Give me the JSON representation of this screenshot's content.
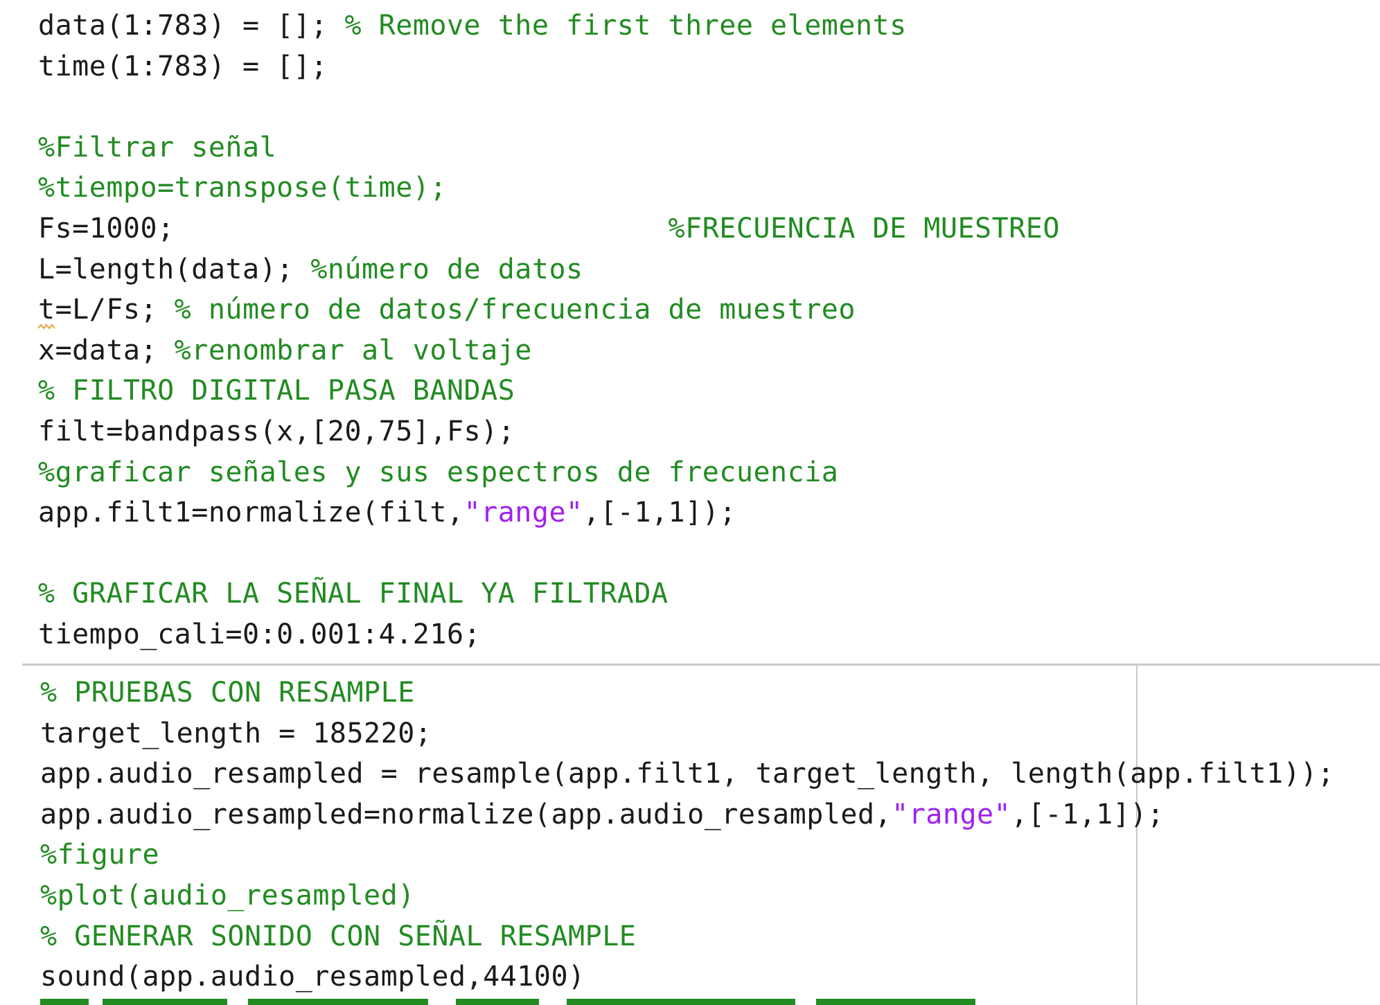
{
  "editor": {
    "section1": [
      {
        "code": "data(1:783) = []; ",
        "comment": "% Remove the first three elements"
      },
      {
        "code": "time(1:783) = [];"
      },
      {
        "code": ""
      },
      {
        "comment": "%Filtrar señal"
      },
      {
        "comment": "%tiempo=transpose(time);"
      },
      {
        "code": "Fs=1000;                             ",
        "comment": "%FRECUENCIA DE MUESTREO"
      },
      {
        "code": "L=length(data); ",
        "comment": "%número de datos"
      },
      {
        "code": "t=L/Fs; ",
        "comment": "% número de datos/frecuencia de muestreo"
      },
      {
        "code": "x=data; ",
        "comment": "%renombrar al voltaje"
      },
      {
        "comment": "% FILTRO DIGITAL PASA BANDAS"
      },
      {
        "code": "filt=bandpass(x,[20,75],Fs);"
      },
      {
        "comment": "%graficar señales y sus espectros de frecuencia"
      },
      {
        "code": "app.filt1=normalize(filt,",
        "string": "\"range\"",
        "after": ",[-1,1]);"
      },
      {
        "code": ""
      },
      {
        "comment": "% GRAFICAR LA SEÑAL FINAL YA FILTRADA"
      },
      {
        "code": "tiempo_cali=0:0.001:4.216;"
      }
    ],
    "section2": [
      {
        "comment": "% PRUEBAS CON RESAMPLE"
      },
      {
        "code": "target_length = 185220;"
      },
      {
        "code": "app.audio_resampled = resample(app.filt1, target_length, length(app.filt1));"
      },
      {
        "code": "app.audio_resampled=normalize(app.audio_resampled,",
        "string": "\"range\"",
        "after": ",[-1,1]);"
      },
      {
        "comment": "%figure"
      },
      {
        "comment": "%plot(audio_resampled)"
      },
      {
        "comment": "% GENERAR SONIDO CON SEÑAL RESAMPLE"
      },
      {
        "code": "sound(app.audio_resampled,44100)"
      }
    ]
  },
  "colors": {
    "code": "#1a1a1a",
    "comment": "#228b22",
    "string": "#a020f0",
    "divider": "#c9c9c9",
    "background": "#ffffff"
  }
}
